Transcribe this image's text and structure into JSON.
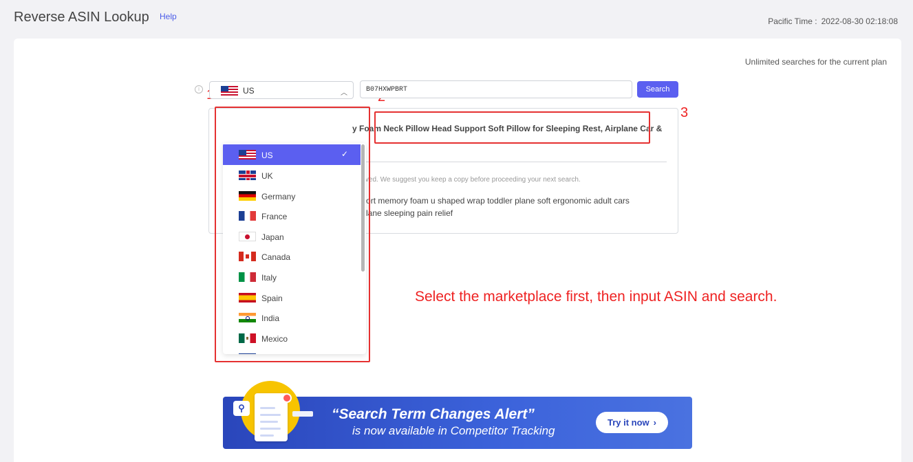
{
  "header": {
    "title": "Reverse ASIN Lookup",
    "help_label": "Help",
    "pacific_label": "Pacific Time :",
    "pacific_time": "2022-08-30 02:18:08"
  },
  "plan_note": "Unlimited searches for the current plan",
  "annotations": {
    "step1": "1",
    "step2": "2",
    "step3": "3",
    "instruction": "Select the marketplace first, then input ASIN and search.",
    "color": "#ee2222"
  },
  "marketplace": {
    "selected": "US",
    "selected_flag": "us-flag-icon",
    "options": [
      {
        "label": "US",
        "flag": "us-flag-icon",
        "selected": true
      },
      {
        "label": "UK",
        "flag": "uk-flag-icon"
      },
      {
        "label": "Germany",
        "flag": "germany-flag-icon"
      },
      {
        "label": "France",
        "flag": "france-flag-icon"
      },
      {
        "label": "Japan",
        "flag": "japan-flag-icon"
      },
      {
        "label": "Canada",
        "flag": "canada-flag-icon"
      },
      {
        "label": "Italy",
        "flag": "italy-flag-icon"
      },
      {
        "label": "Spain",
        "flag": "spain-flag-icon"
      },
      {
        "label": "India",
        "flag": "india-flag-icon"
      },
      {
        "label": "Mexico",
        "flag": "mexico-flag-icon"
      }
    ]
  },
  "search": {
    "asin_value": "B07HXWPBRT",
    "button_label": "Search",
    "accent": "#5b5ff0"
  },
  "result": {
    "title": "y Foam Neck Pillow Head Support Soft Pillow for Sleeping Rest, Airplane Car &",
    "save_note": "e saved. We suggest you keep a copy before proceeding your next search.",
    "keywords_line1": "upport memory foam u shaped wrap toddler plane soft ergonomic adult cars",
    "keywords_line2": "airplane sleeping pain relief"
  },
  "banner": {
    "headline": "“Search Term Changes Alert”",
    "subline": "is now available in Competitor Tracking",
    "button_label": "Try it now",
    "button_icon": "chevron-right-icon"
  }
}
